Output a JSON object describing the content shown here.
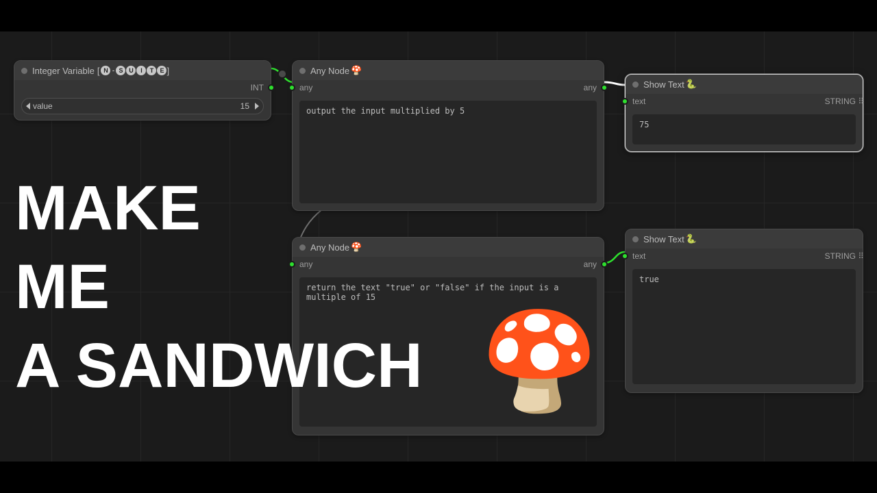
{
  "nodes": {
    "intvar": {
      "title": "Integer Variable",
      "suite_prefix": "[",
      "suite_letters": [
        "N",
        "-",
        "S",
        "U",
        "I",
        "T",
        "E"
      ],
      "suite_suffix": "]",
      "out_label": "INT",
      "field_label": "value",
      "field_value": "15"
    },
    "any1": {
      "title": "Any Node",
      "in_label": "any",
      "out_label": "any",
      "prompt": "output the input multiplied by 5"
    },
    "any2": {
      "title": "Any Node",
      "in_label": "any",
      "out_label": "any",
      "prompt": "return the text \"true\" or \"false\" if the input is a multiple of 15"
    },
    "show1": {
      "title": "Show Text",
      "in_label": "text",
      "out_label": "STRING",
      "value": "75"
    },
    "show2": {
      "title": "Show Text",
      "in_label": "text",
      "out_label": "STRING",
      "value": "true"
    }
  },
  "icons": {
    "mushroom": "🍄",
    "snake": "🐍"
  },
  "overlay": {
    "line1": "MAKE",
    "line2": "ME",
    "line3": "A SANDWICH",
    "emoji": "🍄"
  }
}
